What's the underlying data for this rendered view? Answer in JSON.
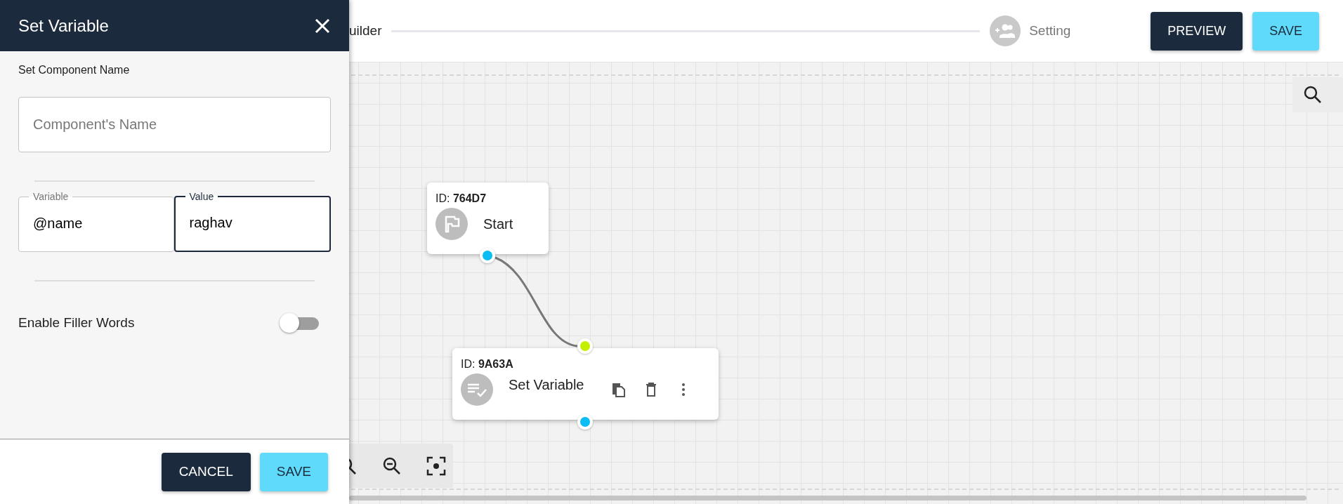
{
  "header": {
    "breadcrumb": "uilder",
    "step": "Setting",
    "buttons": [
      {
        "label": "PREVIEW",
        "kind": "dark"
      },
      {
        "label": "SAVE",
        "kind": "primary"
      }
    ]
  },
  "nodes": [
    {
      "id_line": "ID: **764D7**",
      "title": "Start",
      "kind": "start"
    },
    {
      "id_line": "ID: **9A63A**",
      "title": "Set Variable",
      "kind": "action"
    }
  ],
  "drawer": {
    "title": "Set Variable",
    "section_label": "Set Component Name",
    "name_field": {
      "placeholder": "Component's Name"
    },
    "fields": [
      {
        "label": "Variable",
        "value": "@name",
        "focused": false
      },
      {
        "label": "Value",
        "value": "raghav",
        "focused": true
      }
    ],
    "toggle": {
      "label": "Enable Filler Words",
      "on": false
    },
    "buttons": [
      {
        "label": "CANCEL",
        "kind": "dark"
      },
      {
        "label": "SAVE",
        "kind": "primary"
      }
    ]
  }
}
